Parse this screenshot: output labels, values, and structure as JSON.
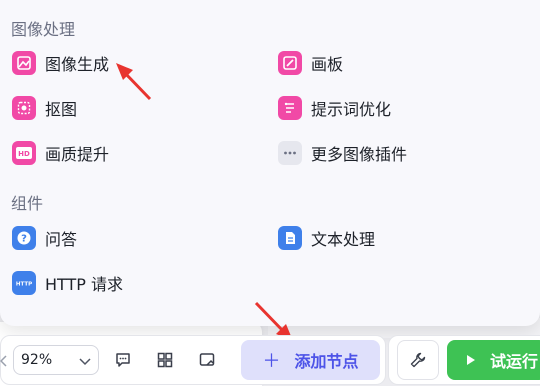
{
  "panel": {
    "section_image": "图像处理",
    "section_components": "组件",
    "image_items": [
      {
        "label": "图像生成",
        "icon": "image-generate-icon"
      },
      {
        "label": "画板",
        "icon": "canvas-board-icon"
      },
      {
        "label": "抠图",
        "icon": "cutout-icon"
      },
      {
        "label": "提示词优化",
        "icon": "prompt-optimize-icon"
      },
      {
        "label": "画质提升",
        "icon": "hd-quality-icon"
      },
      {
        "label": "更多图像插件",
        "icon": "more-dots-icon"
      }
    ],
    "component_items": [
      {
        "label": "问答",
        "icon": "question-answer-icon"
      },
      {
        "label": "文本处理",
        "icon": "text-processing-icon"
      },
      {
        "label": "HTTP 请求",
        "icon": "http-request-icon"
      }
    ]
  },
  "toolbar": {
    "zoom_value": "92%",
    "add_node_label": "添加节点",
    "run_label": "试运行"
  },
  "colors": {
    "pink_icon": "#f149a6",
    "blue_icon": "#3f80ea",
    "accent": "#4d53e8",
    "run_green": "#3ec254",
    "annotation_arrow": "#e8342f"
  }
}
